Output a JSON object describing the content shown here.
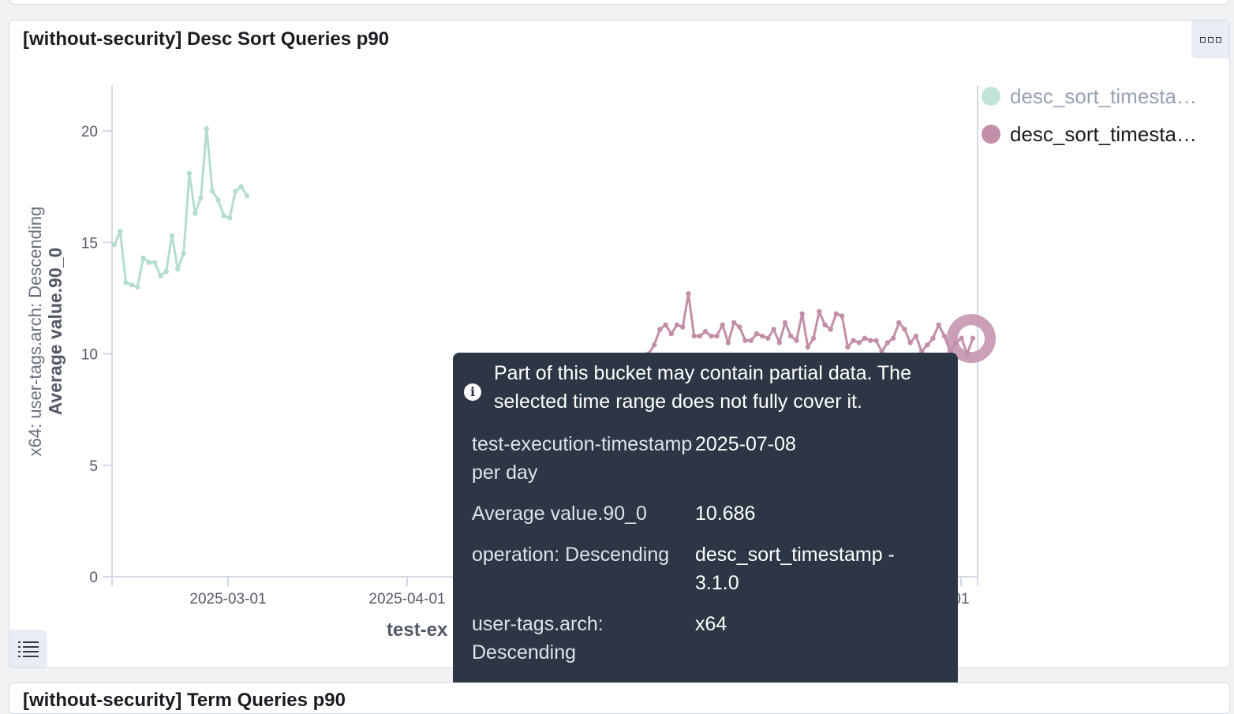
{
  "colors": {
    "series_1": "#a7d7c7",
    "series_2": "#c28ea8",
    "tooltip_bg": "#2c3644",
    "axis": "#d3dae6"
  },
  "panel_main": {
    "title": "[without-security] Desc Sort Queries p90",
    "options_icon": "more-options-icon",
    "legend_toggle_icon": "legend-list-icon"
  },
  "panel_next": {
    "title": "[without-security] Term Queries p90"
  },
  "legend": {
    "items": [
      {
        "label": "desc_sort_timesta…",
        "color": "#a7d7c7",
        "dimmed": true
      },
      {
        "label": "desc_sort_timesta…",
        "color": "#c28ea8",
        "dimmed": false
      }
    ]
  },
  "chart_data": {
    "type": "line",
    "ylabel_line1": "x64: user-tags.arch: Descending",
    "ylabel_line2": "Average value.90_0",
    "xlabel": "test-ex",
    "yticks": [
      "0",
      "5",
      "10",
      "15",
      "20"
    ],
    "xticks": [
      "2025-03-01",
      "2025-04-01",
      "01"
    ],
    "ylim": [
      0,
      21.5
    ],
    "grid": false,
    "legend_position": "top-right",
    "series": [
      {
        "color": "#a7d7c7",
        "dimmed": true,
        "values": [
          14.9,
          15.5,
          13.2,
          13.1,
          13.0,
          14.3,
          14.1,
          14.1,
          13.5,
          13.7,
          15.3,
          13.8,
          14.5,
          18.1,
          16.3,
          17.0,
          20.1,
          17.3,
          16.9,
          16.2,
          16.1,
          17.3,
          17.5,
          17.1
        ]
      },
      {
        "color": "#c28ea8",
        "dimmed": false,
        "values": [
          10.0,
          10.4,
          11.1,
          11.3,
          10.9,
          11.3,
          11.2,
          12.7,
          10.8,
          10.8,
          11.0,
          10.8,
          10.8,
          11.3,
          10.5,
          11.4,
          11.2,
          10.6,
          10.6,
          10.9,
          10.8,
          10.7,
          11.1,
          10.5,
          11.4,
          10.8,
          10.6,
          11.8,
          10.3,
          10.7,
          11.9,
          11.3,
          11.1,
          11.8,
          11.7,
          10.3,
          10.6,
          10.5,
          10.7,
          10.6,
          10.6,
          10.1,
          10.5,
          10.7,
          11.4,
          11.1,
          10.5,
          10.8,
          10.1,
          10.4,
          10.7,
          11.3,
          10.8,
          10.1,
          10.5,
          10.7,
          10.0,
          10.7
        ],
        "highlight": {
          "date": "2025-07-08",
          "value": 10.686
        }
      }
    ]
  },
  "tooltip": {
    "message": "Part of this bucket may contain partial data. The selected time range does not fully cover it.",
    "rows": [
      {
        "key": "test-execution-timestamp per day",
        "value": "2025-07-08"
      },
      {
        "key": "Average value.90_0",
        "value": "10.686"
      },
      {
        "key": "operation: Descending",
        "value": "desc_sort_timestamp - 3.1.0"
      },
      {
        "key": "user-tags.arch: Descending",
        "value": "x64"
      }
    ]
  }
}
